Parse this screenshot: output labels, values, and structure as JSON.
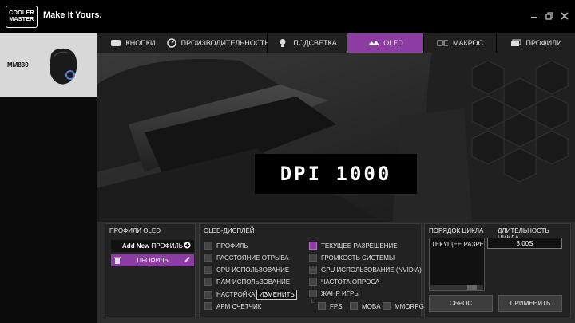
{
  "header": {
    "logo_line1": "COOLER",
    "logo_line2": "MASTER",
    "tagline": "Make It Yours."
  },
  "window_controls": [
    "minimize-icon",
    "restore-icon",
    "close-icon"
  ],
  "device": {
    "name": "MM830"
  },
  "tabs": [
    {
      "label": "КНОПКИ",
      "icon": "keyboard-icon",
      "active": false
    },
    {
      "label": "ПРОИЗВОДИТЕЛЬНОСТЬ",
      "icon": "gauge-icon",
      "active": false
    },
    {
      "label": "ПОДСВЕТКА",
      "icon": "bulb-icon",
      "active": false
    },
    {
      "label": "OLED",
      "icon": "oled-icon",
      "active": true
    },
    {
      "label": "МАКРОС",
      "icon": "macro-icon",
      "active": false
    },
    {
      "label": "ПРОФИЛИ",
      "icon": "profiles-icon",
      "active": false
    }
  ],
  "oled_preview": {
    "text": "DPI 1000"
  },
  "profiles_panel": {
    "title": "ПРОФИЛИ OLED",
    "add_new_bold": "Add New",
    "add_new_rest": "ПРОФИЛЬ",
    "selected_profile": "ПРОФИЛЬ"
  },
  "display_panel": {
    "title": "OLED-ДИСПЛЕЙ",
    "left_options": [
      {
        "label": "ПРОФИЛЬ",
        "checked": false
      },
      {
        "label": "РАССТОЯНИЕ ОТРЫВА",
        "checked": false
      },
      {
        "label": "CPU ИСПОЛЬЗОВАНИЕ",
        "checked": false
      },
      {
        "label": "RAM ИСПОЛЬЗОВАНИЕ",
        "checked": false
      },
      {
        "label": "НАСТРОЙКА",
        "checked": false
      },
      {
        "label": "APM СЧЕТЧИК",
        "checked": false
      }
    ],
    "edit_button": "ИЗМЕНИТЬ",
    "right_options": [
      {
        "label": "ТЕКУЩЕЕ РАЗРЕШЕНИЕ",
        "checked": true
      },
      {
        "label": "ГРОМКОСТЬ СИСТЕМЫ",
        "checked": false
      },
      {
        "label": "GPU ИСПОЛЬЗОВАНИЕ (NVIDIA)",
        "checked": false
      },
      {
        "label": "ЧАСТОТА ОПРОСА",
        "checked": false
      },
      {
        "label": "ЖАНР ИГРЫ",
        "checked": false
      }
    ],
    "genres": [
      {
        "label": "FPS",
        "checked": false
      },
      {
        "label": "MOBA",
        "checked": false
      },
      {
        "label": "MMORPG",
        "checked": false
      }
    ]
  },
  "cycle_panel": {
    "order_title": "ПОРЯДОК ЦИКЛА",
    "duration_title": "ДЛИТЕЛЬНОСТЬ ЦИКЛА",
    "list_items": [
      "ТЕКУЩЕЕ РАЗРЕШ"
    ],
    "duration_value": "3,00S",
    "reset_button": "СБРОС",
    "apply_button": "ПРИМЕНИТЬ"
  },
  "colors": {
    "accent": "#8d3ca3",
    "background": "#0b0b0b",
    "panel": "#2d2d2d"
  }
}
